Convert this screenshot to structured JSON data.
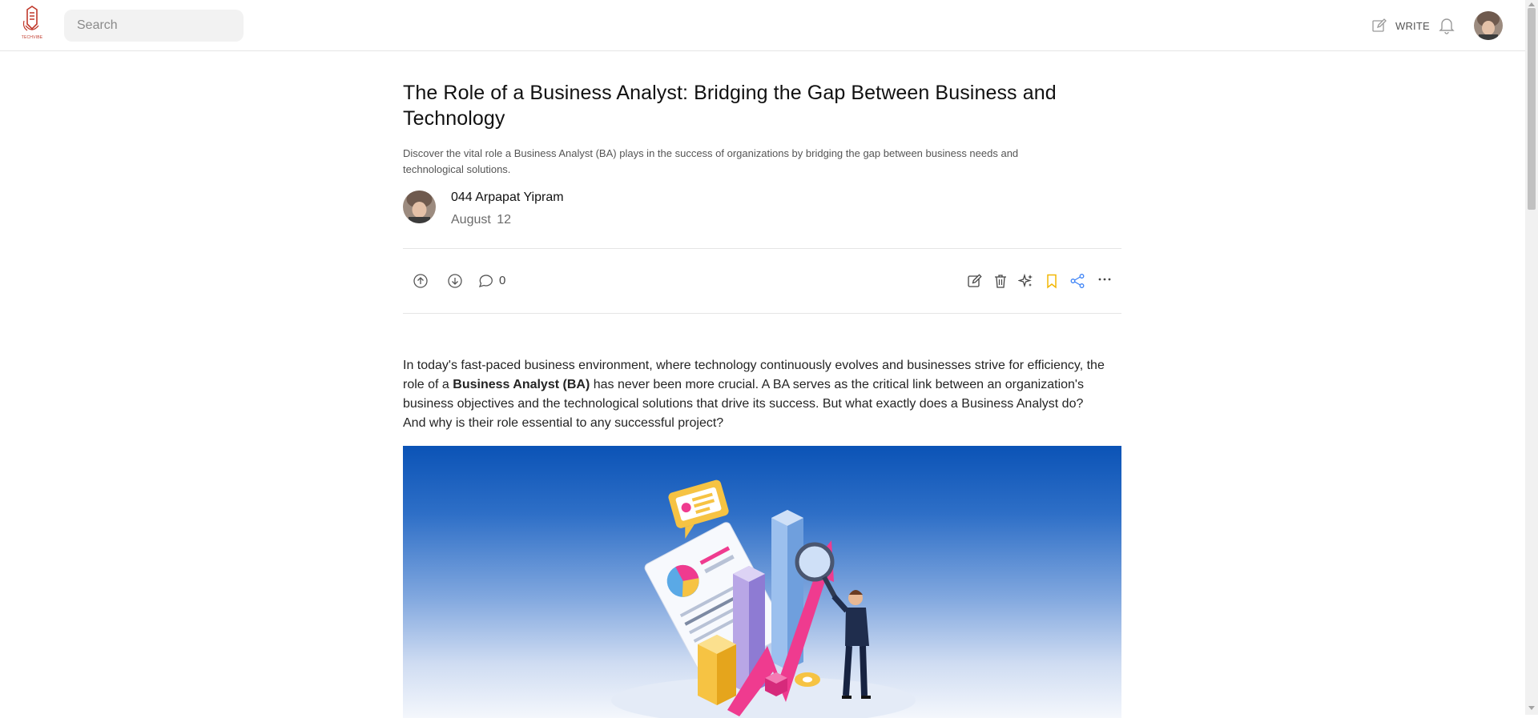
{
  "brand": {
    "logo_text": "TECHVIBE",
    "accent": "#c0392b"
  },
  "nav": {
    "search_placeholder": "Search",
    "write_label": "WRITE",
    "icons": {
      "write": "pencil-square-icon",
      "notifications": "bell-icon",
      "profile": "user-avatar"
    }
  },
  "article": {
    "title": "The Role of a Business Analyst: Bridging the Gap Between Business and Technology",
    "subtitle": "Discover the vital role a Business Analyst (BA) plays in the success of organizations by bridging the gap between business needs and technological solutions.",
    "author_name": "044 Arpapat Yipram",
    "date": "August 12",
    "comment_count": "0",
    "actions": [
      "upvote-icon",
      "downvote-icon",
      "comment-icon",
      "edit-icon",
      "trash-icon",
      "sparkle-icon",
      "bookmark-icon",
      "share-icon",
      "more-icon"
    ],
    "colors": {
      "bookmark": "#f2b705",
      "share": "#3b82f6"
    },
    "body": {
      "intro_before": "In today's fast-paced business environment, where technology continuously evolves and businesses strive for efficiency, the role of a ",
      "intro_bold": "Business Analyst (BA)",
      "intro_after": " has never been more crucial. A BA serves as the critical link between an organization's business objectives and the technological solutions that drive its success. But what exactly does a Business Analyst do? And why is their role essential to any successful project?"
    },
    "hero_image": "business-analytics-illustration"
  }
}
